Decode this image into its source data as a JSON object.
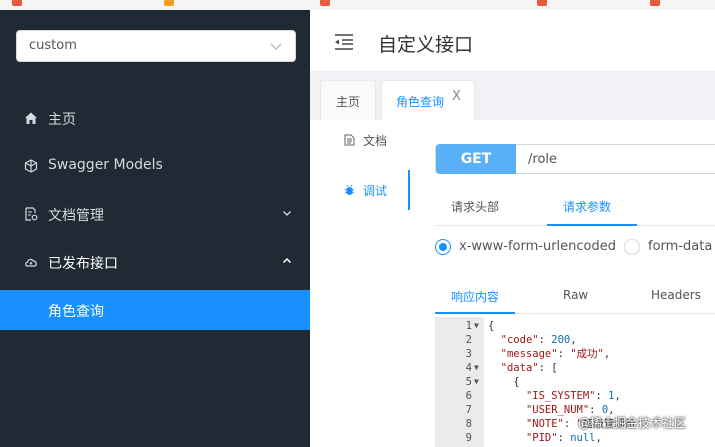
{
  "sidebar": {
    "select": {
      "value": "custom"
    },
    "items": [
      {
        "label": "主页",
        "icon": "home-icon"
      },
      {
        "label": "Swagger Models",
        "icon": "cube-icon"
      },
      {
        "label": "文档管理",
        "icon": "doc-settings-icon"
      },
      {
        "label": "已发布接口",
        "icon": "cloud-icon"
      },
      {
        "label": "角色查询"
      }
    ]
  },
  "header": {
    "title": "自定义接口"
  },
  "tabs": [
    {
      "label": "主页"
    },
    {
      "label": "角色查询",
      "close": "X"
    }
  ],
  "content": {
    "side_tabs": [
      {
        "label": "文档"
      },
      {
        "label": "调试"
      }
    ],
    "method": "GET",
    "url": "/role",
    "request_tabs": [
      "请求头部",
      "请求参数"
    ],
    "body_types": [
      "x-www-form-urlencoded",
      "form-data"
    ],
    "response_tabs": [
      "响应内容",
      "Raw",
      "Headers"
    ],
    "code": {
      "line_numbers": [
        "1",
        "2",
        "3",
        "4",
        "5",
        "6",
        "7",
        "8",
        "9"
      ]
    }
  },
  "watermark": "@稀土掘金技术社区",
  "watermark_overlay": "超级管理员",
  "colors": {
    "sidebar_bg": "#202a35",
    "accent": "#1890ff",
    "method_bg": "#5ab0f7"
  }
}
